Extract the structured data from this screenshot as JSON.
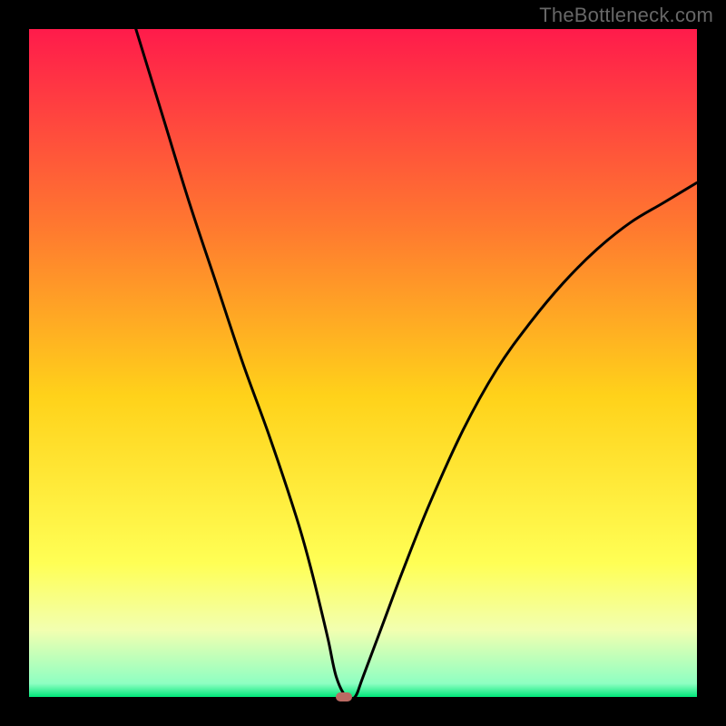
{
  "attribution": "TheBottleneck.com",
  "chart_data": {
    "type": "line",
    "title": "",
    "xlabel": "",
    "ylabel": "",
    "xlim": [
      0,
      100
    ],
    "ylim": [
      0,
      100
    ],
    "gradient_stops": [
      {
        "offset": 0.0,
        "color": "#ff1b4b"
      },
      {
        "offset": 0.3,
        "color": "#ff7a2f"
      },
      {
        "offset": 0.55,
        "color": "#ffd21a"
      },
      {
        "offset": 0.8,
        "color": "#ffff55"
      },
      {
        "offset": 0.9,
        "color": "#f2ffb0"
      },
      {
        "offset": 0.98,
        "color": "#8effc2"
      },
      {
        "offset": 1.0,
        "color": "#00e67a"
      }
    ],
    "series": [
      {
        "name": "bottleneck-curve",
        "x": [
          16,
          20,
          24,
          28,
          32,
          36,
          40,
          42,
          43.5,
          44.8,
          46.0,
          47.5,
          48.8,
          50.0,
          53,
          56,
          60,
          65,
          70,
          75,
          80,
          85,
          90,
          95,
          100
        ],
        "y": [
          100,
          87,
          74,
          62,
          50,
          39,
          27,
          20,
          14,
          8.5,
          3.0,
          0.0,
          0.0,
          3.0,
          11,
          19,
          29,
          40,
          49,
          56,
          62,
          67,
          71,
          74,
          77
        ]
      }
    ],
    "marker": {
      "x": 47.2,
      "y": 0.0,
      "color": "#bb6a63"
    }
  }
}
